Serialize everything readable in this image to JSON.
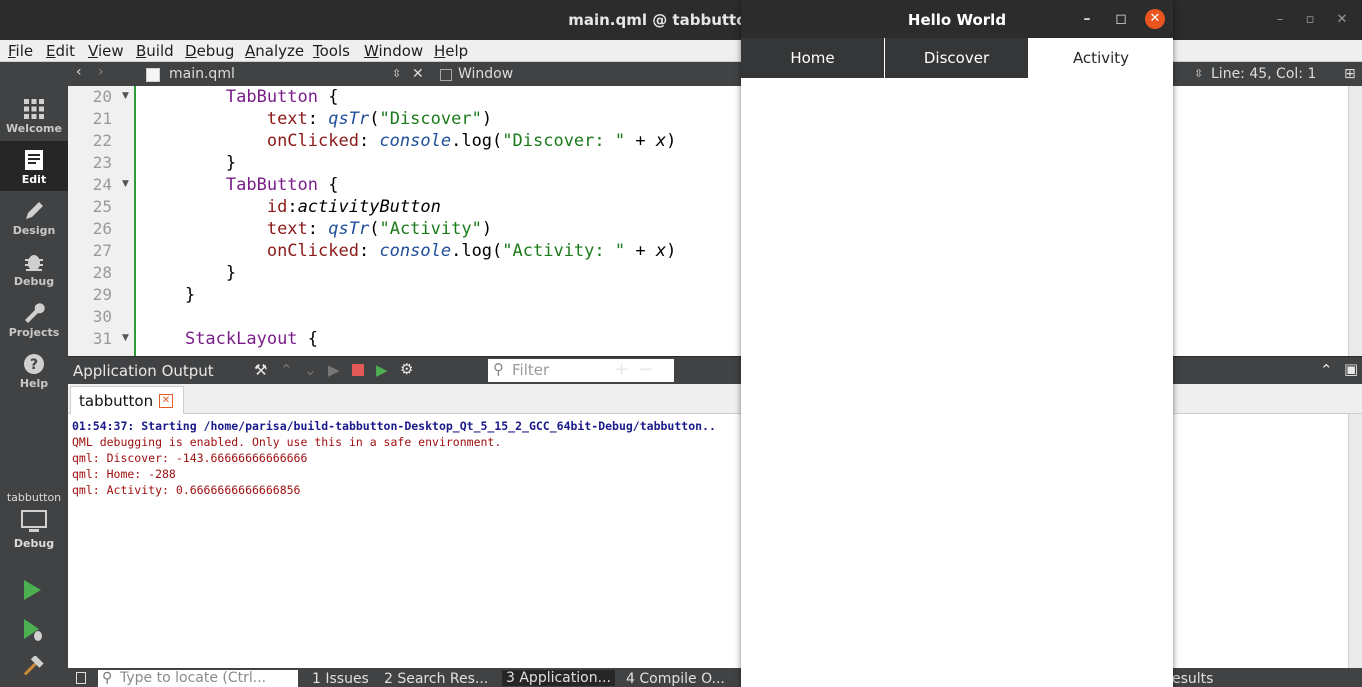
{
  "window": {
    "title": "main.qml @ tabbutton - Qt",
    "minimize": "–",
    "maximize": "▫",
    "close": "✕"
  },
  "menu": [
    {
      "label": "File",
      "accel": "F"
    },
    {
      "label": "Edit",
      "accel": "E"
    },
    {
      "label": "View",
      "accel": "V"
    },
    {
      "label": "Build",
      "accel": "B"
    },
    {
      "label": "Debug",
      "accel": "D"
    },
    {
      "label": "Analyze",
      "accel": "A"
    },
    {
      "label": "Tools",
      "accel": "T"
    },
    {
      "label": "Window",
      "accel": "W"
    },
    {
      "label": "Help",
      "accel": "H"
    }
  ],
  "modes": [
    {
      "label": "Welcome",
      "icon": "grid-icon",
      "active": false
    },
    {
      "label": "Edit",
      "icon": "document-icon",
      "active": true
    },
    {
      "label": "Design",
      "icon": "pencil-icon",
      "active": false
    },
    {
      "label": "Debug",
      "icon": "bug-icon",
      "active": false
    },
    {
      "label": "Projects",
      "icon": "wrench-icon",
      "active": false
    },
    {
      "label": "Help",
      "icon": "question-icon",
      "active": false
    }
  ],
  "kit": {
    "project": "tabbutton",
    "mode": "Debug"
  },
  "editor_toolbar": {
    "file": "main.qml",
    "symbol": "Window",
    "position": "Line: 45, Col: 1"
  },
  "code_lines": [
    {
      "n": "20",
      "fold": true
    },
    {
      "n": "21",
      "fold": false
    },
    {
      "n": "22",
      "fold": false
    },
    {
      "n": "23",
      "fold": false
    },
    {
      "n": "24",
      "fold": true
    },
    {
      "n": "25",
      "fold": false
    },
    {
      "n": "26",
      "fold": false
    },
    {
      "n": "27",
      "fold": false
    },
    {
      "n": "28",
      "fold": false
    },
    {
      "n": "29",
      "fold": false
    },
    {
      "n": "30",
      "fold": false
    },
    {
      "n": "31",
      "fold": true
    }
  ],
  "code_text": {
    "tabbutton": "TabButton",
    "brace_open": " {",
    "brace_close": "}",
    "text_prop": "text",
    "onclicked_prop": "onClicked",
    "id_prop": "id",
    "qstr": "qsTr",
    "console": "console",
    "log": ".log(",
    "discover_str": "\"Discover\"",
    "discover_log": "\"Discover: \"",
    "activity_id": "activityButton",
    "activity_str": "\"Activity\"",
    "activity_log": "\"Activity: \"",
    "plus_x": " + ",
    "x": "x",
    "close_paren": ")",
    "stacklayout": "StackLayout"
  },
  "output": {
    "pane_title": "Application Output",
    "filter_placeholder": "Filter",
    "tab_label": "tabbutton",
    "lines": [
      {
        "kind": "start",
        "text": "01:54:37: Starting /home/parisa/build-tabbutton-Desktop_Qt_5_15_2_GCC_64bit-Debug/tabbutton.."
      },
      {
        "kind": "msg",
        "text": "QML debugging is enabled. Only use this in a safe environment."
      },
      {
        "kind": "msg",
        "text": "qml: Discover: -143.66666666666666"
      },
      {
        "kind": "msg",
        "text": "qml: Home: -288"
      },
      {
        "kind": "msg",
        "text": "qml: Activity: 0.6666666666666856"
      }
    ]
  },
  "statusbar": {
    "locator_placeholder": "Type to locate (Ctrl...",
    "tabs": [
      "1  Issues",
      "2  Search Res...",
      "3  Application...",
      "4  Compile O..."
    ],
    "right_text": "esults"
  },
  "app_window": {
    "title": "Hello World",
    "tabs": [
      {
        "label": "Home",
        "checked": false
      },
      {
        "label": "Discover",
        "checked": false
      },
      {
        "label": "Activity",
        "checked": true
      }
    ]
  }
}
